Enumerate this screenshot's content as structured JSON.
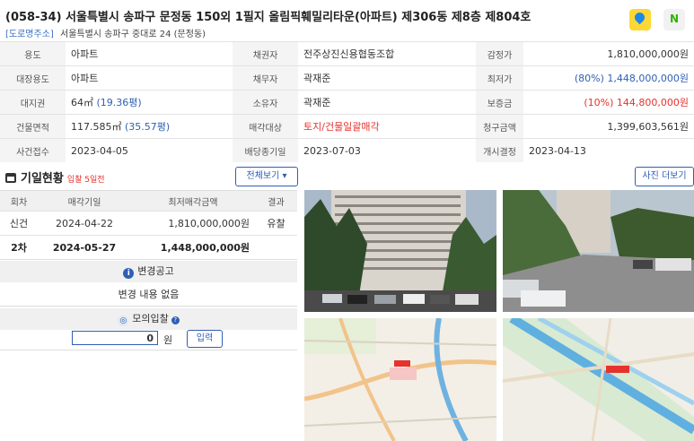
{
  "header": {
    "title": "(058-34) 서울특별시 송파구 문정동 150외 1필지 올림픽훼밀리타운(아파트) 제306동 제8층 제804호",
    "road_tag": "[도로명주소]",
    "road_address": "서울특별시 송파구 중대로 24 (문정동)",
    "map_icons": [
      "kakao-map-icon",
      "naver-map-icon"
    ]
  },
  "info": {
    "usage_label": "용도",
    "usage": "아파트",
    "creditor_label": "채권자",
    "creditor": "전주상진신용협동조합",
    "appraisal_label": "감정가",
    "appraisal": "1,810,000,000원",
    "ledger_label": "대장용도",
    "ledger": "아파트",
    "debtor_label": "채무자",
    "debtor": "곽재준",
    "minimum_label": "최저가",
    "minimum": "(80%) 1,448,000,000원",
    "land_label": "대지권",
    "land_m2": "64㎡",
    "land_py": "(19.36평)",
    "owner_label": "소유자",
    "owner": "곽재준",
    "deposit_label": "보증금",
    "deposit": "(10%) 144,800,000원",
    "area_label": "건물면적",
    "area_m2": "117.585㎡",
    "area_py": "(35.57평)",
    "target_label": "매각대상",
    "target": "토지/건물일괄매각",
    "claim_label": "청구금액",
    "claim": "1,399,603,561원",
    "received_label": "사건접수",
    "received": "2023-04-05",
    "dividend_label": "배당종기일",
    "dividend": "2023-07-03",
    "start_label": "개시결정",
    "start": "2023-04-13"
  },
  "schedule": {
    "title": "기일현황",
    "subtitle": "입찰 5일전",
    "view_all": "전체보기 ▾",
    "photo_more": "사진 더보기",
    "columns": [
      "회차",
      "매각기일",
      "최저매각금액",
      "결과"
    ],
    "rows": [
      {
        "round": "신건",
        "date": "2024-04-22",
        "amount": "1,810,000,000원",
        "result": "유찰"
      },
      {
        "round": "2차",
        "date": "2024-05-27",
        "amount": "1,448,000,000원",
        "result": ""
      }
    ]
  },
  "notice": {
    "title": "변경공고",
    "body": "변경 내용 없음"
  },
  "mock_bid": {
    "title": "모의입찰",
    "help": "?",
    "value": "0",
    "unit": "원",
    "button": "입력"
  },
  "colors": {
    "accent": "#2f5fb3",
    "alert": "#e5322d"
  }
}
